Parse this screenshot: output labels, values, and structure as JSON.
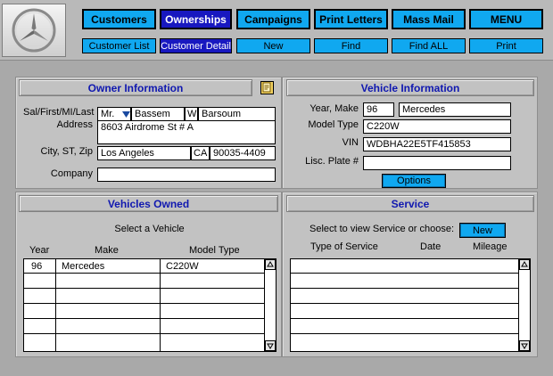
{
  "nav": {
    "main": [
      {
        "label": "Customers",
        "active": false
      },
      {
        "label": "Ownerships",
        "active": true
      },
      {
        "label": "Campaigns",
        "active": false
      },
      {
        "label": "Print Letters",
        "active": false
      },
      {
        "label": "Mass Mail",
        "active": false
      },
      {
        "label": "MENU",
        "active": false
      }
    ],
    "sub": [
      {
        "label": "Customer List",
        "active": false
      },
      {
        "label": "Customer Detail",
        "active": true
      },
      {
        "label": "New",
        "active": false
      },
      {
        "label": "Find",
        "active": false
      },
      {
        "label": "Find ALL",
        "active": false
      },
      {
        "label": "Print",
        "active": false
      }
    ]
  },
  "owner": {
    "title": "Owner Information",
    "label_name": "Sal/First/MI/Last",
    "label_address": "Address",
    "label_city": "City, ST, Zip",
    "label_company": "Company",
    "salutation": "Mr.",
    "first": "Bassem",
    "mi": "W",
    "last": "Barsoum",
    "address": "8603 Airdrome St # A",
    "city": "Los Angeles",
    "state": "CA",
    "zip": "90035-4409",
    "company": ""
  },
  "vehicle": {
    "title": "Vehicle Information",
    "label_year_make": "Year, Make",
    "label_model": "Model Type",
    "label_vin": "VIN",
    "label_plate": "Lisc. Plate #",
    "year": "96",
    "make": "Mercedes",
    "model": "C220W",
    "vin": "WDBHA22E5TF415853",
    "plate": "",
    "options_label": "Options"
  },
  "owned": {
    "title": "Vehicles Owned",
    "subtitle": "Select a Vehicle",
    "columns": [
      "Year",
      "Make",
      "Model Type"
    ],
    "rows": [
      [
        "96",
        "Mercedes",
        "C220W"
      ],
      [
        "",
        "",
        ""
      ],
      [
        "",
        "",
        ""
      ],
      [
        "",
        "",
        ""
      ],
      [
        "",
        "",
        ""
      ],
      [
        "",
        "",
        ""
      ]
    ]
  },
  "service": {
    "title": "Service",
    "prompt": "Select to view Service or choose:",
    "new_label": "New",
    "columns": [
      "Type of Service",
      "Date",
      "Mileage"
    ],
    "rows": [
      [
        "",
        "",
        ""
      ],
      [
        "",
        "",
        ""
      ],
      [
        "",
        "",
        ""
      ],
      [
        "",
        "",
        ""
      ],
      [
        "",
        "",
        ""
      ],
      [
        "",
        "",
        ""
      ]
    ]
  },
  "icons": {
    "logo": "mercedes-star-icon",
    "note": "note-icon",
    "dropdown": "triangle-down-icon",
    "scroll_up": "arrow-up-icon",
    "scroll_down": "arrow-down-icon"
  },
  "colors": {
    "nav_button": "#10a8f0",
    "nav_active": "#1818c0",
    "panel_title": "#1018b0",
    "background": "#a9a9a9"
  }
}
